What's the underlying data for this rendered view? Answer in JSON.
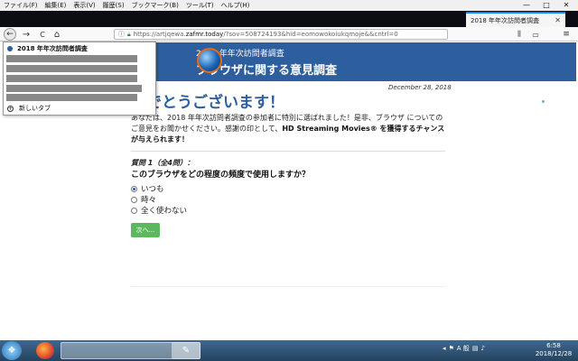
{
  "menubar": {
    "items": [
      "ファイル(F)",
      "編集(E)",
      "表示(V)",
      "履歴(S)",
      "ブックマーク(B)",
      "ツール(T)",
      "ヘルプ(H)"
    ],
    "window_buttons": [
      "—",
      "□",
      "✕"
    ]
  },
  "tab": {
    "title": "2018 年年次訪問者調査",
    "close": "✕"
  },
  "navbar": {
    "url_prefix": "https://artjqewa.",
    "url_domain": "zafmr.today",
    "url_rest": "/?sov=508724193&hid=eomowokoiukqmoje&&cntrl=0",
    "back_label": "←",
    "forward_label": "→",
    "reload_label": "C",
    "home_label": "⌂"
  },
  "dropdown": {
    "title": "2018 年年次訪問者調査",
    "new_tab": "新しいタブ"
  },
  "page": {
    "banner_line1": "2018 年年次訪問者調査",
    "banner_line2": "ブラウザに関する意見調査",
    "date": "December 28, 2018",
    "congrats": "めでとうございます！",
    "body_pre": "あなたは、2018 年年次訪問者調査の参加者に特別に選ばれました！是非、ブラウザ についての ご意見をお聞かせください。感謝の印として、",
    "body_bold": "HD Streaming Movies® を獲得するチャンスが与えられます！",
    "question_num": "質問 1（全4問）：",
    "question_text": "このブラウザをどの程度の頻度で使用しますか？",
    "options": [
      "いつも",
      "時々",
      "全く使わない"
    ],
    "next_label": "次へ..."
  },
  "taskbar": {
    "tray_lang": "A 般",
    "clock_time": "6:58",
    "clock_date": "2018/12/28"
  }
}
